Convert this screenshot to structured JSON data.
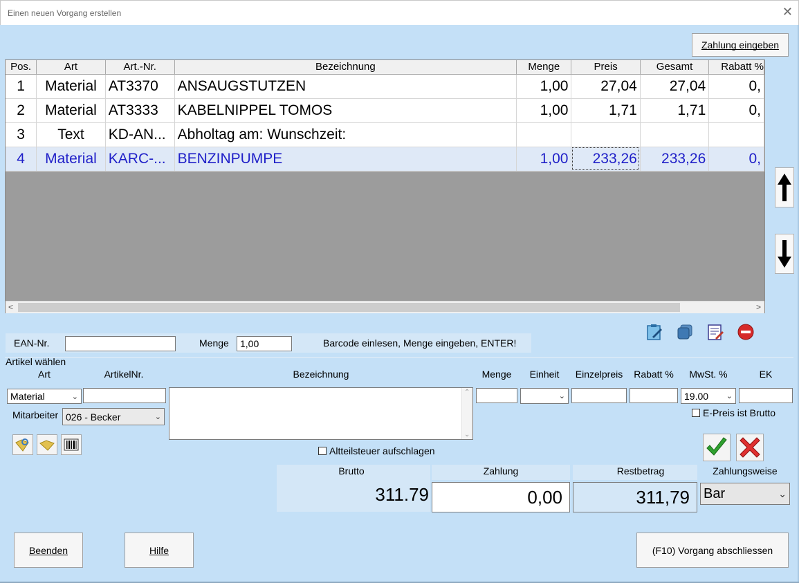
{
  "window": {
    "title": "Einen neuen Vorgang erstellen",
    "close": "✕"
  },
  "buttons": {
    "zahlung_eingeben": "Zahlung eingeben",
    "beenden": "Beenden",
    "hilfe": "Hilfe",
    "abschliessen": "(F10) Vorgang abschliessen"
  },
  "grid": {
    "columns": [
      "Pos.",
      "Art",
      "Art.-Nr.",
      "Bezeichnung",
      "Menge",
      "Preis",
      "Gesamt",
      "Rabatt %"
    ],
    "rows": [
      {
        "pos": "1",
        "art": "Material",
        "artnr": "AT3370",
        "bez": "ANSAUGSTUTZEN",
        "menge": "1,00",
        "preis": "27,04",
        "gesamt": "27,04",
        "rabatt": "0,"
      },
      {
        "pos": "2",
        "art": "Material",
        "artnr": "AT3333",
        "bez": "KABELNIPPEL TOMOS",
        "menge": "1,00",
        "preis": "1,71",
        "gesamt": "1,71",
        "rabatt": "0,"
      },
      {
        "pos": "3",
        "art": "Text",
        "artnr": "KD-AN...",
        "bez": "Abholtag am: Wunschzeit:",
        "menge": "",
        "preis": "",
        "gesamt": "",
        "rabatt": ""
      },
      {
        "pos": "4",
        "art": "Material",
        "artnr": "KARC-...",
        "bez": "BENZINPUMPE",
        "menge": "1,00",
        "preis": "233,26",
        "gesamt": "233,26",
        "rabatt": "0,"
      }
    ],
    "selected_row": 4
  },
  "scan": {
    "ean_label": "EAN-Nr.",
    "ean_value": "",
    "menge_label": "Menge",
    "menge_value": "1,00",
    "hint": "Barcode einlesen, Menge eingeben, ENTER!"
  },
  "artikel": {
    "section_label": "Artikel wählen",
    "headers": {
      "art": "Art",
      "artikelnr": "ArtikelNr.",
      "bezeichnung": "Bezeichnung",
      "menge": "Menge",
      "einheit": "Einheit",
      "einzelpreis": "Einzelpreis",
      "rabatt": "Rabatt %",
      "mwst": "MwSt. %",
      "ek": "EK"
    },
    "art_value": "Material",
    "mwst_value": "19.00",
    "mitarbeiter_label": "Mitarbeiter",
    "mitarbeiter_value": "026 - Becker",
    "epreis_brutto_label": "E-Preis ist Brutto",
    "altteil_label": "Altteilsteuer aufschlagen"
  },
  "totals": {
    "brutto_label": "Brutto",
    "brutto_value": "311.79",
    "zahlung_label": "Zahlung",
    "zahlung_value": "0,00",
    "rest_label": "Restbetrag",
    "rest_value": "311,79",
    "zahlungsweise_label": "Zahlungsweise",
    "zahlungsweise_value": "Bar"
  }
}
